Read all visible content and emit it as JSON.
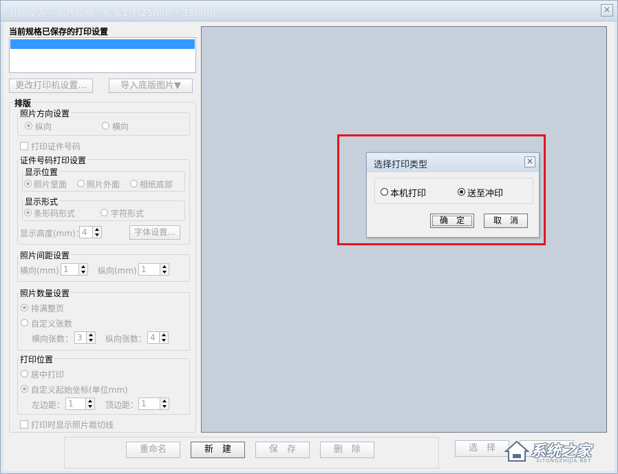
{
  "window": {
    "title": "打印设置---照片规格：标准1寸(25mm * 35mm)",
    "close_glyph": "×"
  },
  "left": {
    "saved_label": "当前规格已保存的打印设置",
    "buttons": {
      "printer_settings": "更改打印机设置...",
      "import_base": "导入底版图片▼"
    },
    "layout": {
      "title": "排版",
      "orientation": {
        "title": "照片方向设置",
        "portrait": "纵向",
        "landscape": "横向"
      },
      "print_id_checkbox": "打印证件号码",
      "id_print": {
        "title": "证件号码打印设置",
        "position": {
          "title": "显示位置",
          "inside": "照片里面",
          "outside": "照片外面",
          "bottom": "相纸底部"
        },
        "format": {
          "title": "显示形式",
          "barcode": "条形码形式",
          "chars": "字符形式"
        },
        "height_label": "显示高度(mm)：",
        "height_value": "4",
        "font_button": "字体设置..."
      },
      "spacing": {
        "title": "照片间距设置",
        "h_label": "横向(mm)：",
        "h_value": "1",
        "v_label": "纵向(mm)：",
        "v_value": "1"
      },
      "count": {
        "title": "照片数量设置",
        "fill_page": "排满整页",
        "custom": "自定义张数",
        "h_label": "横向张数：",
        "h_value": "3",
        "v_label": "纵向张数：",
        "v_value": "4"
      },
      "position": {
        "title": "打印位置",
        "center": "居中打印",
        "custom": "自定义起始坐标(单位mm)",
        "left_label": "左边距：",
        "left_value": "1",
        "top_label": "顶边距：",
        "top_value": "1"
      },
      "cutline_checkbox": "打印时显示照片裁切线"
    }
  },
  "dialog": {
    "title": "选择打印类型",
    "close_glyph": "×",
    "option_local": "本机打印",
    "option_send": "送至冲印",
    "ok": "确　定",
    "cancel": "取　消"
  },
  "bottom": {
    "rename": "重命名",
    "new": "新　建",
    "save": "保　存",
    "delete": "删　除",
    "select": "选　择",
    "cut": "剪"
  },
  "watermark": {
    "text": "系统之家",
    "subtext": "XITONGZHIJIA.NET"
  }
}
